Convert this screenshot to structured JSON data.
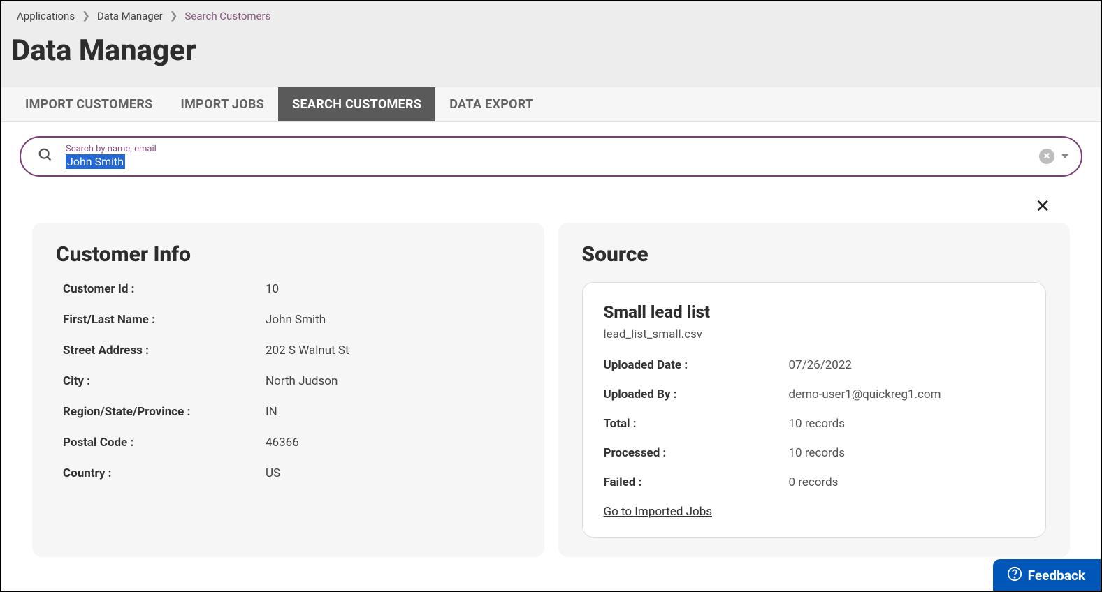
{
  "breadcrumb": {
    "items": [
      "Applications",
      "Data Manager",
      "Search Customers"
    ]
  },
  "page_title": "Data Manager",
  "tabs": [
    "IMPORT CUSTOMERS",
    "IMPORT JOBS",
    "SEARCH CUSTOMERS",
    "DATA EXPORT"
  ],
  "active_tab_index": 2,
  "search": {
    "label": "Search by name, email",
    "value": "John Smith"
  },
  "customer_info": {
    "heading": "Customer Info",
    "rows": [
      {
        "label": "Customer Id :",
        "value": "10"
      },
      {
        "label": "First/Last Name :",
        "value": "John Smith"
      },
      {
        "label": "Street Address :",
        "value": "202 S Walnut St"
      },
      {
        "label": "City :",
        "value": "North Judson"
      },
      {
        "label": "Region/State/Province :",
        "value": "IN"
      },
      {
        "label": "Postal Code :",
        "value": "46366"
      },
      {
        "label": "Country :",
        "value": "US"
      }
    ]
  },
  "source": {
    "heading": "Source",
    "title": "Small lead list",
    "filename": "lead_list_small.csv",
    "rows": [
      {
        "label": "Uploaded Date :",
        "value": "07/26/2022"
      },
      {
        "label": "Uploaded By :",
        "value": "demo-user1@quickreg1.com"
      },
      {
        "label": "Total :",
        "value": "10 records"
      },
      {
        "label": "Processed :",
        "value": "10 records"
      },
      {
        "label": "Failed :",
        "value": "0 records"
      }
    ],
    "link": "Go to Imported Jobs"
  },
  "feedback_label": "Feedback"
}
